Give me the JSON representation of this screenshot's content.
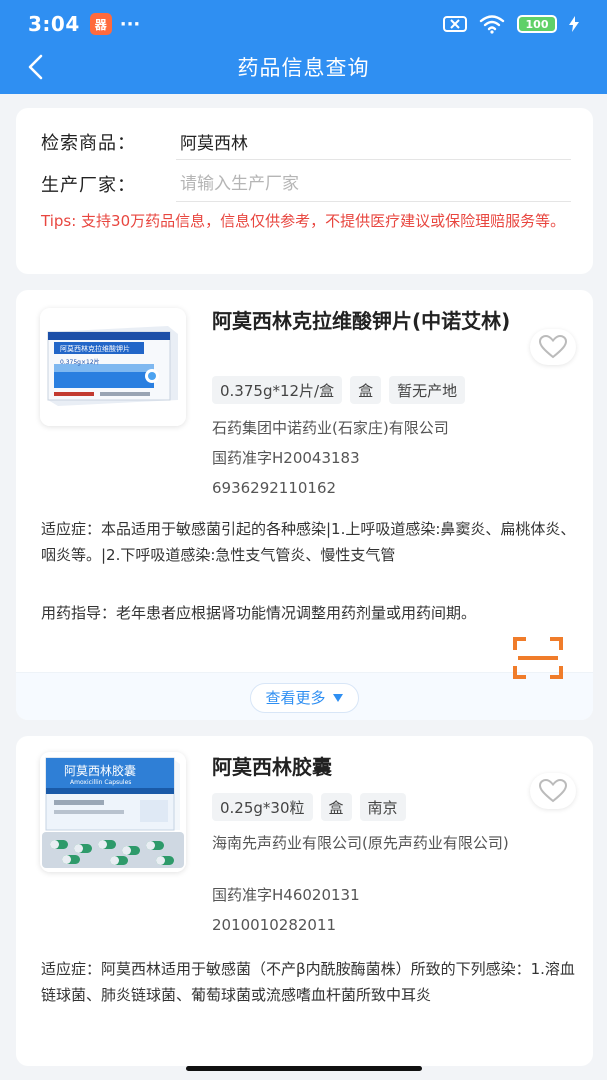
{
  "status_bar": {
    "time": "3:04",
    "app_icon_glyph": "器",
    "dots": "···",
    "battery": "100"
  },
  "nav": {
    "title": "药品信息查询"
  },
  "search": {
    "product_label": "检索商品：",
    "product_value": "阿莫西林",
    "maker_label": "生产厂家：",
    "maker_placeholder": "请输入生产厂家",
    "tips": "Tips: 支持30万药品信息，信息仅供参考，不提供医疗建议或保险理赔服务等。"
  },
  "products": [
    {
      "name": "阿莫西林克拉维酸钾片(中诺艾林)",
      "tags": [
        "0.375g*12片/盒",
        "盒",
        "暂无产地"
      ],
      "manufacturer": "石药集团中诺药业(石家庄)有限公司",
      "approval": "国药准字H20043183",
      "barcode": "6936292110162",
      "indication": "适应症：本品适用于敏感菌引起的各种感染|1.上呼吸道感染:鼻窦炎、扁桃体炎、咽炎等。|2.下呼吸道感染:急性支气管炎、慢性支气管",
      "guidance": "用药指导：老年患者应根据肾功能情况调整用药剂量或用药间期。",
      "more_label": "查看更多",
      "box_label": "阿莫西林克拉维酸钾片",
      "box_spec": "0.375g×12片"
    },
    {
      "name": "阿莫西林胶囊",
      "tags": [
        "0.25g*30粒",
        "盒",
        "南京"
      ],
      "manufacturer": "海南先声药业有限公司(原先声药业有限公司)",
      "approval": "国药准字H46020131",
      "barcode": "2010010282011",
      "indication": "适应症：阿莫西林适用于敏感菌（不产β内酰胺酶菌株）所致的下列感染：1.溶血链球菌、肺炎链球菌、葡萄球菌或流感嗜血杆菌所致中耳炎",
      "box_label": "阿莫西林胶囊",
      "box_sub": "Amoxicillin Capsules"
    }
  ],
  "colors": {
    "primary": "#2f8ff2",
    "tips": "#e8463f",
    "scan": "#f07c2a"
  }
}
